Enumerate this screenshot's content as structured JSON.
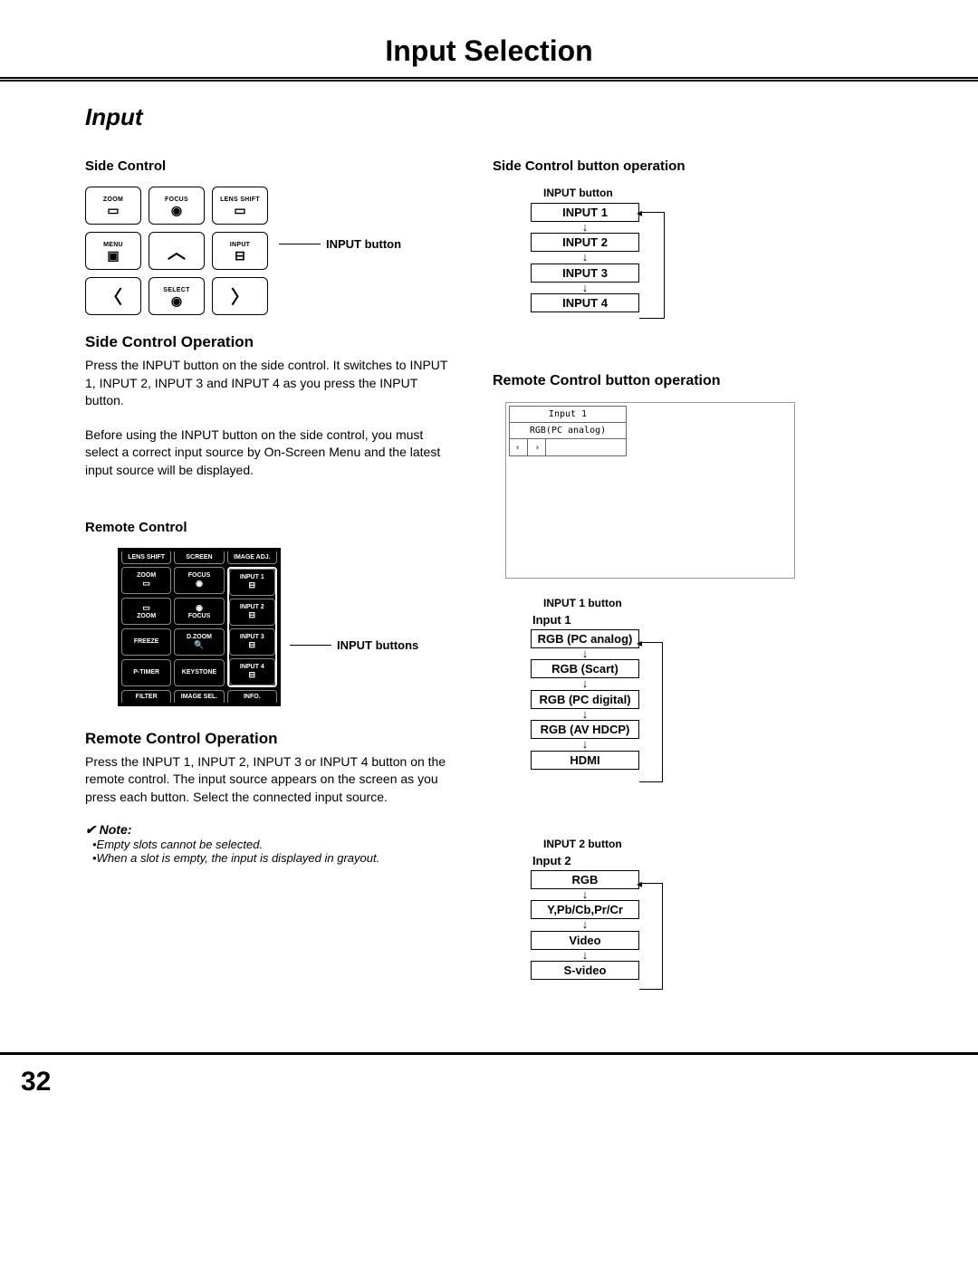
{
  "page": {
    "title": "Input Selection",
    "section": "Input",
    "number": "32"
  },
  "left": {
    "side_control_head": "Side Control",
    "btns": {
      "zoom": "ZOOM",
      "focus": "FOCUS",
      "lens_shift": "LENS SHIFT",
      "menu": "MENU",
      "input": "INPUT",
      "select": "SELECT"
    },
    "callout_input_button": "INPUT button",
    "sco_head": "Side Control Operation",
    "sco_p1": "Press the INPUT button on the side control. It switches to INPUT 1, INPUT 2, INPUT 3 and INPUT 4 as you press the INPUT button.",
    "sco_p2": "Before using the INPUT button on the side control, you must select a correct input source by On-Screen Menu and the latest input source will be displayed.",
    "remote_head": "Remote Control",
    "remote_btns": {
      "lens_shift": "LENS SHIFT",
      "screen": "SCREEN",
      "image_adj": "IMAGE ADJ.",
      "zoom": "ZOOM",
      "focus": "FOCUS",
      "input1": "INPUT 1",
      "input2": "INPUT 2",
      "input3": "INPUT 3",
      "input4": "INPUT 4",
      "zoom2": "ZOOM",
      "focus2": "FOCUS",
      "freeze": "FREEZE",
      "dzoom": "D.ZOOM",
      "ptimer": "P-TIMER",
      "keystone": "KEYSTONE",
      "filter": "FILTER",
      "imagesel": "IMAGE SEL.",
      "info": "INFO."
    },
    "callout_input_buttons": "INPUT buttons",
    "rco_head": "Remote Control Operation",
    "rco_p": "Press the INPUT 1, INPUT 2, INPUT 3 or INPUT 4 button on the remote control. The input source appears on the screen as you press each button. Select the connected input source.",
    "note_head": "✔ Note:",
    "note1": "•Empty slots cannot be selected.",
    "note2": "•When a slot is empty, the input is displayed in grayout."
  },
  "right": {
    "scbo_head": "Side Control button operation",
    "diag1_label": "INPUT button",
    "diag1": [
      "INPUT 1",
      "INPUT 2",
      "INPUT 3",
      "INPUT 4"
    ],
    "rcbo_head": "Remote Control button operation",
    "osd": {
      "line1": "Input 1",
      "line2": "RGB(PC analog)"
    },
    "diag2_label": "INPUT 1 button",
    "diag2_first": "Input 1",
    "diag2": [
      "RGB (PC analog)",
      "RGB (Scart)",
      "RGB (PC digital)",
      "RGB (AV HDCP)",
      "HDMI"
    ],
    "diag3_label": "INPUT 2 button",
    "diag3_first": "Input 2",
    "diag3": [
      "RGB",
      "Y,Pb/Cb,Pr/Cr",
      "Video",
      "S-video"
    ]
  }
}
